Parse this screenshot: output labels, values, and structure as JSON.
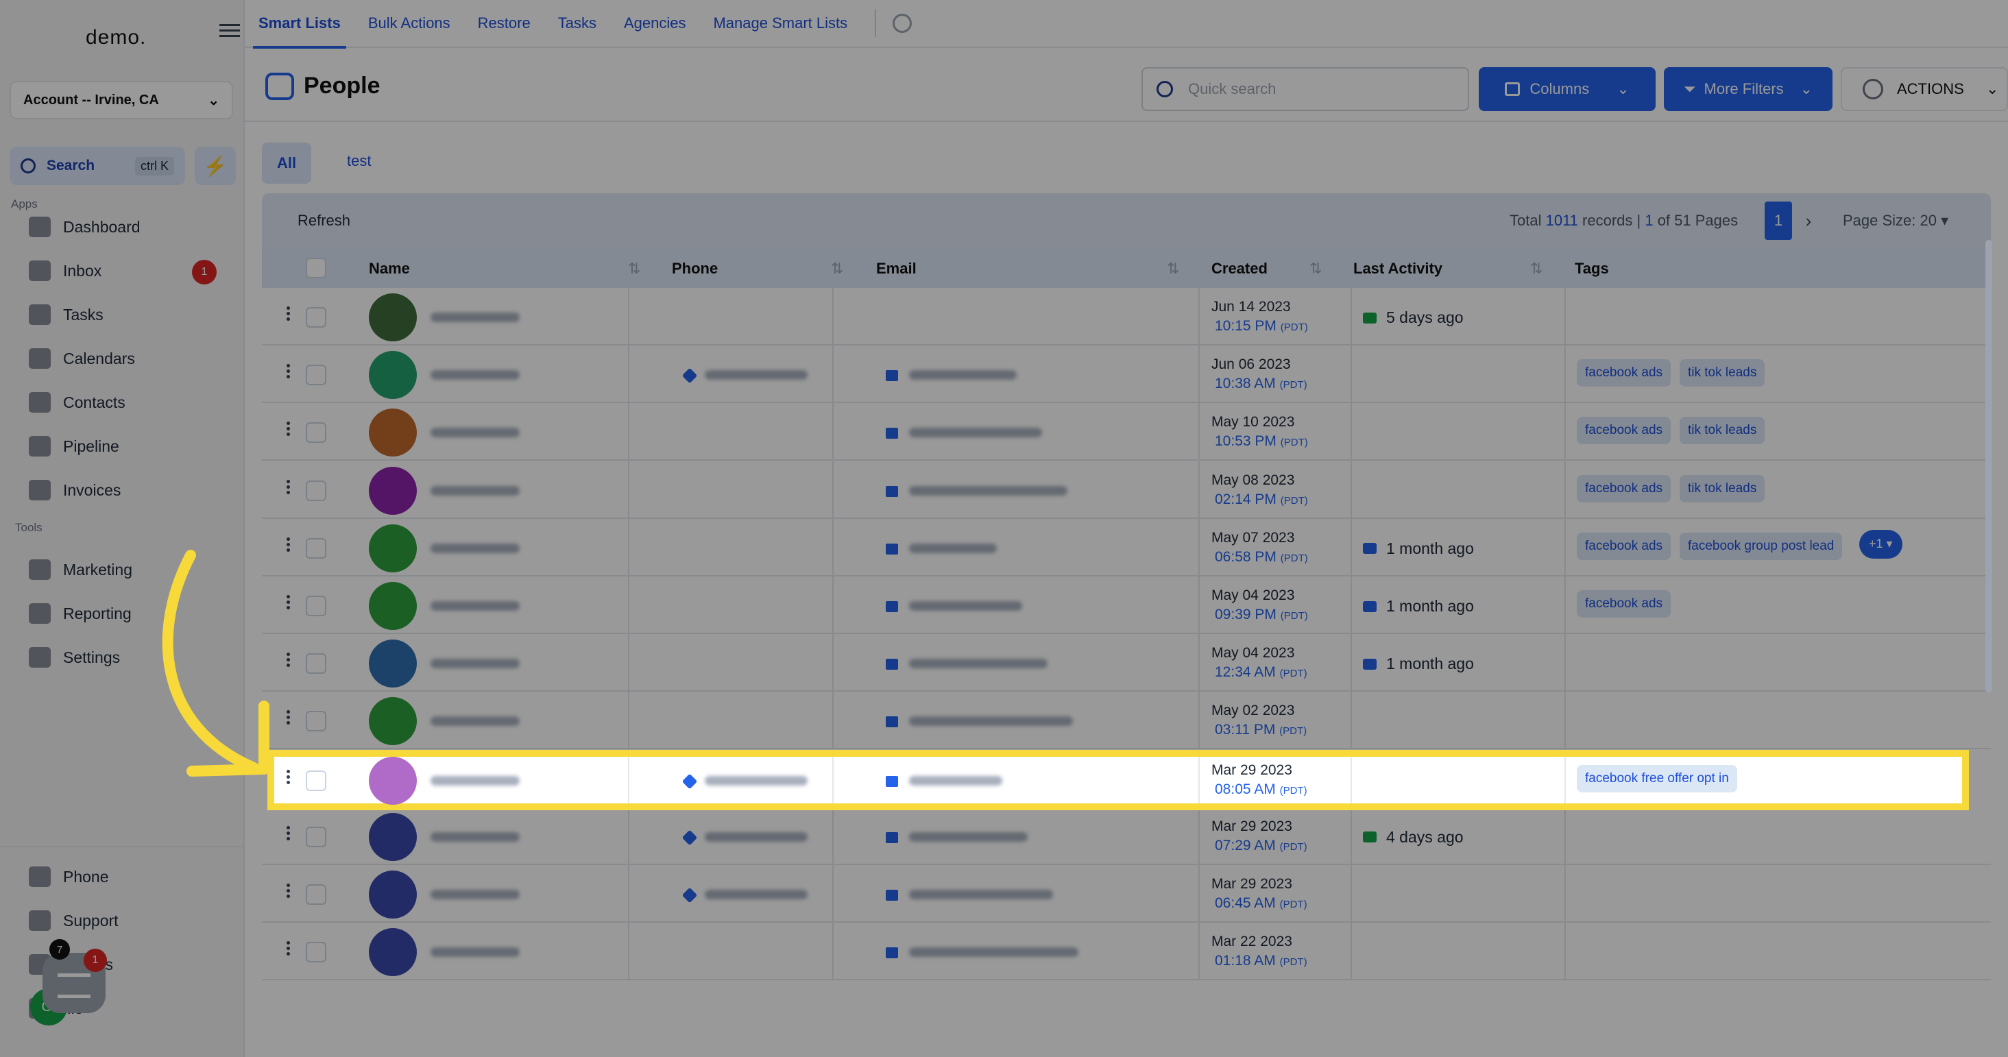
{
  "sidebar": {
    "logo": "demo.",
    "account": "Account -- Irvine, CA",
    "search_label": "Search",
    "search_shortcut": "ctrl K",
    "apps_label": "Apps",
    "tools_label": "Tools",
    "apps": [
      {
        "label": "Dashboard",
        "icon": "dashboard-icon"
      },
      {
        "label": "Inbox",
        "icon": "inbox-icon",
        "badge": "1"
      },
      {
        "label": "Tasks",
        "icon": "tasks-icon"
      },
      {
        "label": "Calendars",
        "icon": "calendar-icon"
      },
      {
        "label": "Contacts",
        "icon": "contacts-icon"
      },
      {
        "label": "Pipeline",
        "icon": "pipeline-icon"
      },
      {
        "label": "Invoices",
        "icon": "invoices-icon"
      }
    ],
    "tools": [
      {
        "label": "Marketing",
        "icon": "megaphone-icon"
      },
      {
        "label": "Reporting",
        "icon": "pie-chart-icon"
      },
      {
        "label": "Settings",
        "icon": "gear-icon"
      }
    ],
    "bottom": [
      {
        "label": "Phone",
        "icon": "phone-icon"
      },
      {
        "label": "Support",
        "icon": "support-icon"
      },
      {
        "label": "cations",
        "icon": "notifications-icon"
      },
      {
        "label": "file",
        "icon": "profile-icon"
      }
    ],
    "chat_badge": "1",
    "chat_badge2": "7",
    "avatar_initials": "GI"
  },
  "topnav": {
    "tabs": [
      "Smart Lists",
      "Bulk Actions",
      "Restore",
      "Tasks",
      "Agencies",
      "Manage Smart Lists"
    ],
    "active": "Smart Lists"
  },
  "header": {
    "title": "People",
    "search_placeholder": "Quick search",
    "columns_label": "Columns",
    "filters_label": "More Filters",
    "actions_label": "ACTIONS"
  },
  "tabs": {
    "all": "All",
    "test": "test"
  },
  "toolbar": {
    "refresh": "Refresh",
    "total_prefix": "Total ",
    "total_count": "1011",
    "total_mid": " records | ",
    "page_current": "1",
    "total_suffix": " of 51 Pages",
    "page_button": "1",
    "page_size": "Page Size: 20"
  },
  "table": {
    "columns": [
      "Name",
      "Phone",
      "Email",
      "Created",
      "Last Activity",
      "Tags"
    ],
    "rows": [
      {
        "date": "Jun 14 2023",
        "time": "10:15 PM",
        "tz": "(PDT)",
        "activity": "5 days ago",
        "activity_type": "chat",
        "tags": [],
        "avatar": "#3f6b3a"
      },
      {
        "date": "Jun 06 2023",
        "time": "10:38 AM",
        "tz": "(PDT)",
        "activity": "",
        "tags": [
          "facebook ads",
          "tik tok leads"
        ],
        "avatar": "#22a06b"
      },
      {
        "date": "May 10 2023",
        "time": "10:53 PM",
        "tz": "(PDT)",
        "activity": "",
        "tags": [
          "facebook ads",
          "tik tok leads"
        ],
        "avatar": "#c06a2c"
      },
      {
        "date": "May 08 2023",
        "time": "02:14 PM",
        "tz": "(PDT)",
        "activity": "",
        "tags": [
          "facebook ads",
          "tik tok leads"
        ],
        "avatar": "#8e24aa"
      },
      {
        "date": "May 07 2023",
        "time": "06:58 PM",
        "tz": "(PDT)",
        "activity": "1 month ago",
        "activity_type": "mail",
        "tags": [
          "facebook ads",
          "facebook group post lead"
        ],
        "plus": "+1 ▾",
        "avatar": "#2e9e3f"
      },
      {
        "date": "May 04 2023",
        "time": "09:39 PM",
        "tz": "(PDT)",
        "activity": "1 month ago",
        "activity_type": "mail",
        "tags": [
          "facebook ads"
        ],
        "avatar": "#2e9e3f"
      },
      {
        "date": "May 04 2023",
        "time": "12:34 AM",
        "tz": "(PDT)",
        "activity": "1 month ago",
        "activity_type": "mail",
        "tags": [],
        "avatar": "#2f6fb0"
      },
      {
        "date": "May 02 2023",
        "time": "03:11 PM",
        "tz": "(PDT)",
        "activity": "",
        "tags": [],
        "avatar": "#2e9e3f"
      },
      {
        "date": "Mar 29 2023",
        "time": "08:05 AM",
        "tz": "(PDT)",
        "activity": "",
        "tags": [
          "facebook free offer opt in"
        ],
        "avatar": "#b06ac8",
        "highlight": true
      },
      {
        "date": "Mar 29 2023",
        "time": "07:29 AM",
        "tz": "(PDT)",
        "activity": "4 days ago",
        "activity_type": "chat",
        "tags": [],
        "avatar": "#3949ab"
      },
      {
        "date": "Mar 29 2023",
        "time": "06:45 AM",
        "tz": "(PDT)",
        "activity": "",
        "tags": [],
        "avatar": "#3949ab"
      },
      {
        "date": "Mar 22 2023",
        "time": "01:18 AM",
        "tz": "(PDT)",
        "activity": "",
        "tags": [],
        "avatar": "#3949ab"
      }
    ]
  },
  "colors": {
    "accent": "#2563eb",
    "highlight": "#f8d93a",
    "badge": "#dc2626"
  }
}
